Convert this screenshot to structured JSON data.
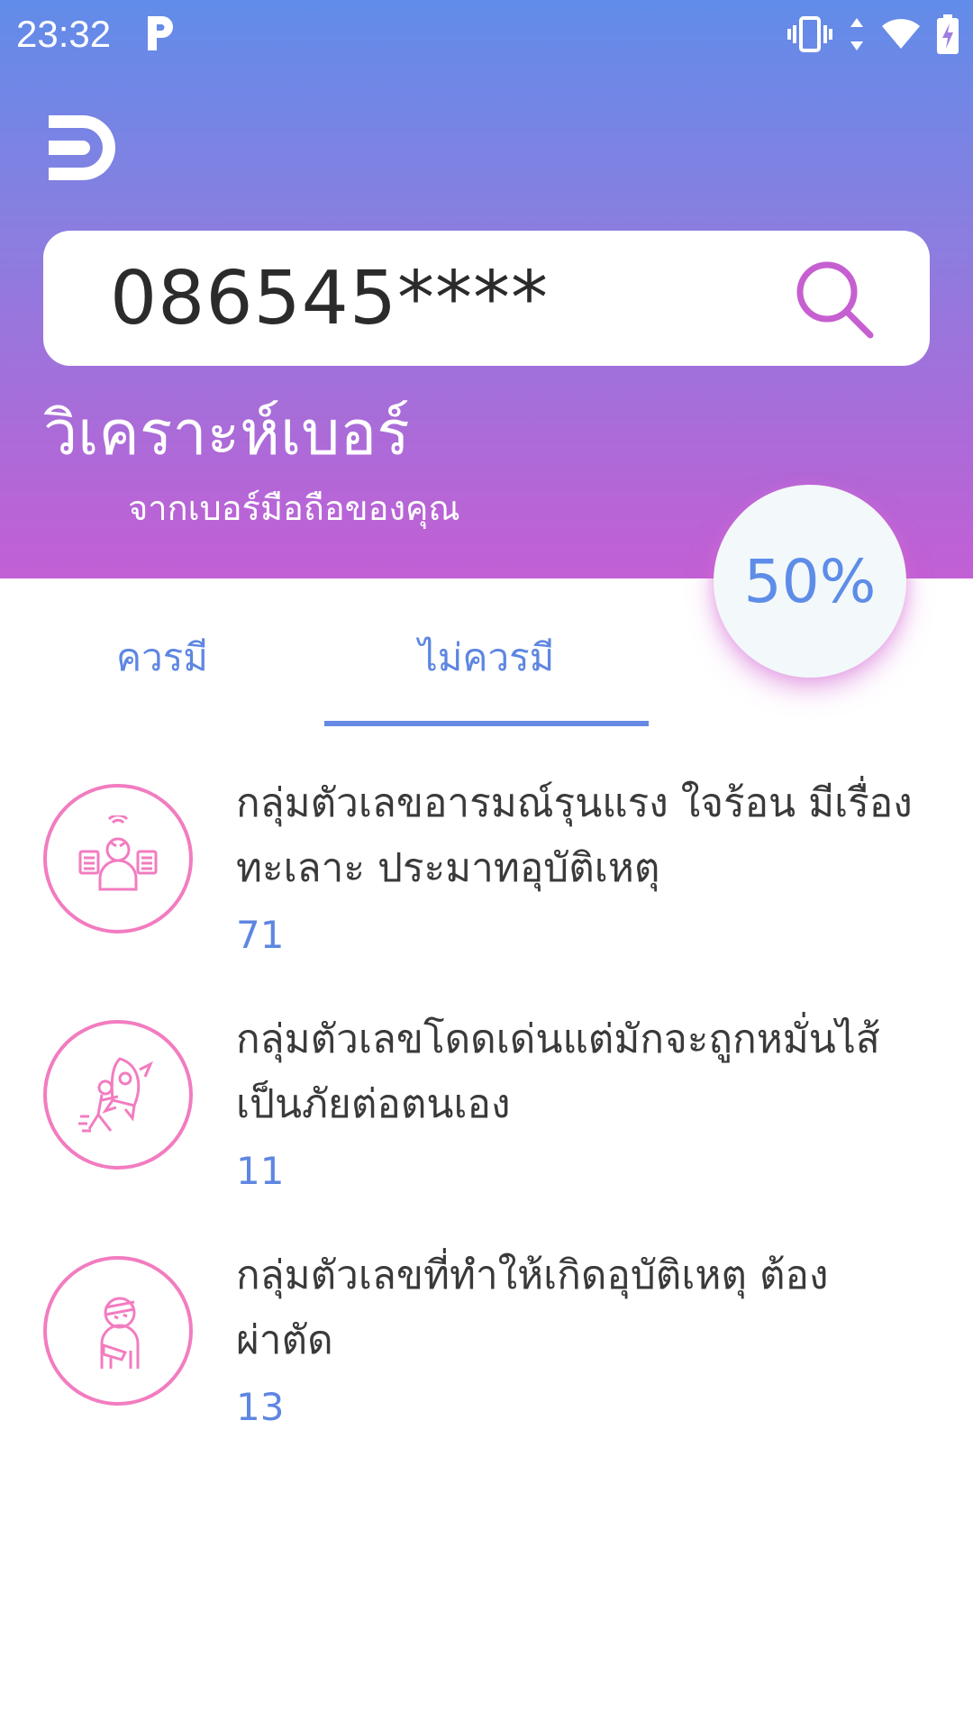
{
  "status_bar": {
    "time": "23:32",
    "icons": [
      "parking-icon",
      "vibrate-icon",
      "data-arrows-icon",
      "wifi-icon",
      "battery-charging-icon"
    ]
  },
  "header": {
    "logo_icon": "app-logo-icon",
    "search": {
      "value": "086545****",
      "icon": "search-icon"
    },
    "title": "วิเคราะห์เบอร์",
    "subtitle": "จากเบอร์มือถือของคุณ",
    "percent": "50%"
  },
  "tabs": [
    {
      "label": "ควรมี",
      "selected": false
    },
    {
      "label": "ไม่ควรมี",
      "selected": true
    }
  ],
  "items": [
    {
      "icon": "angry-person-icon",
      "text": "กลุ่มตัวเลขอารมณ์รุนแรง ใจร้อน มีเรื่องทะเลาะ ประมาทอุบัติเหตุ",
      "count": "71"
    },
    {
      "icon": "rocket-rider-icon",
      "text": "กลุ่มตัวเลขโดดเด่นแต่มักจะถูกหมั่นไส้ เป็นภัยต่อตนเอง",
      "count": "11"
    },
    {
      "icon": "injured-person-icon",
      "text": "กลุ่มตัวเลขที่ทำให้เกิดอุบัติเหตุ ต้องผ่าตัด",
      "count": "13"
    }
  ],
  "colors": {
    "header_top": "#618ce9",
    "header_bottom": "#c35fd5",
    "accent_blue": "#5e86e2",
    "icon_pink": "#f27cc0",
    "search_icon": "#c65fd0"
  }
}
